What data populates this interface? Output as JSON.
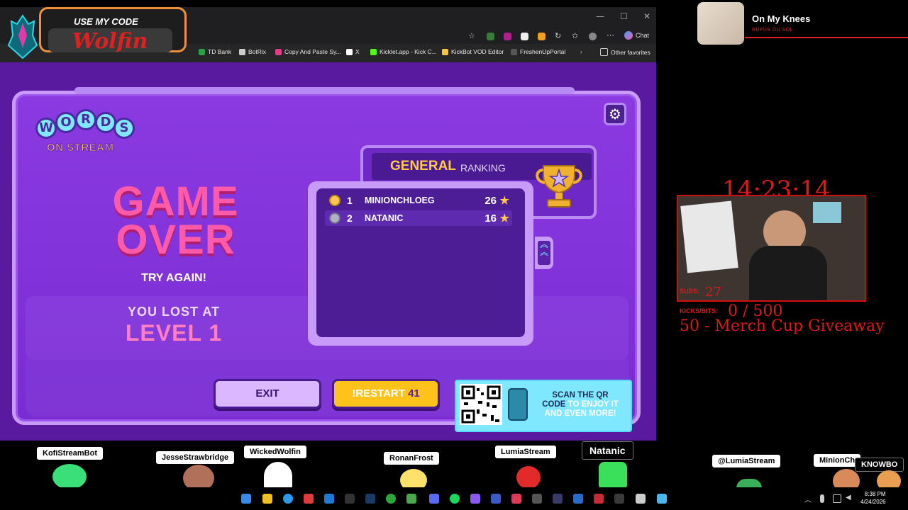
{
  "browser": {
    "bookmarks": [
      {
        "label": "TD Bank",
        "color": "#2e9d45"
      },
      {
        "label": "BotRix",
        "color": "#cccccc"
      },
      {
        "label": "Copy And Paste Sy...",
        "color": "#e33b87"
      },
      {
        "label": "X",
        "color": "#ffffff"
      },
      {
        "label": "Kicklet.app - Kick C...",
        "color": "#53fc18"
      },
      {
        "label": "KickBot VOD Editor",
        "color": "#f5c542"
      },
      {
        "label": "FreshenUpPortal",
        "color": "#555555"
      }
    ],
    "other_favorites": "Other favorites",
    "chat_label": "Chat"
  },
  "overlay": {
    "code_label": "USE MY CODE",
    "code_name": "Wolfin"
  },
  "game": {
    "logo_top": [
      "W",
      "O",
      "R",
      "D",
      "S"
    ],
    "logo_bottom": "ON STREAM",
    "game_over": "GAME OVER",
    "try_again": "TRY AGAIN!",
    "you_lost_at": "YOU LOST AT",
    "level": "LEVEL 1",
    "ranking_title": "GENERAL",
    "ranking_subtitle": "RANKING",
    "rankings": [
      {
        "rank": "1",
        "name": "MINIONCHLOEG",
        "score": "26",
        "medal": "#ffc94a"
      },
      {
        "rank": "2",
        "name": "NATANIC",
        "score": "16",
        "medal": "#b0b0c8"
      }
    ],
    "exit_label": "EXIT",
    "restart_label": "!RESTART",
    "restart_count": "41",
    "qr_text_a": "SCAN THE QR",
    "qr_text_b": "CODE",
    "qr_text_c": "TO ENJOY IT",
    "qr_text_d": "AND EVEN MORE!"
  },
  "music": {
    "song": "On My Knees",
    "artist": "RÜFÜS DU SOL"
  },
  "stream": {
    "timer": "14:23:14",
    "subs_label": "SUBS:",
    "subs_count": "27",
    "kicks_label": "KICKS/BITS:",
    "kicks_value": "0 / 500",
    "goal": "50 - Merch Cup Giveaway"
  },
  "chatters": [
    {
      "name": "KofiStreamBot"
    },
    {
      "name": "JesseStrawbridge"
    },
    {
      "name": "WickedWolfin"
    },
    {
      "name": "RonanFrost"
    },
    {
      "name": "LumiaStream"
    },
    {
      "name": "Natanic"
    },
    {
      "name": "@LumiaStream"
    },
    {
      "name": "MinionCh"
    },
    {
      "name": "KNOWBO"
    }
  ],
  "taskbar": {
    "time": "8:38 PM",
    "date": "4/24/2026"
  }
}
